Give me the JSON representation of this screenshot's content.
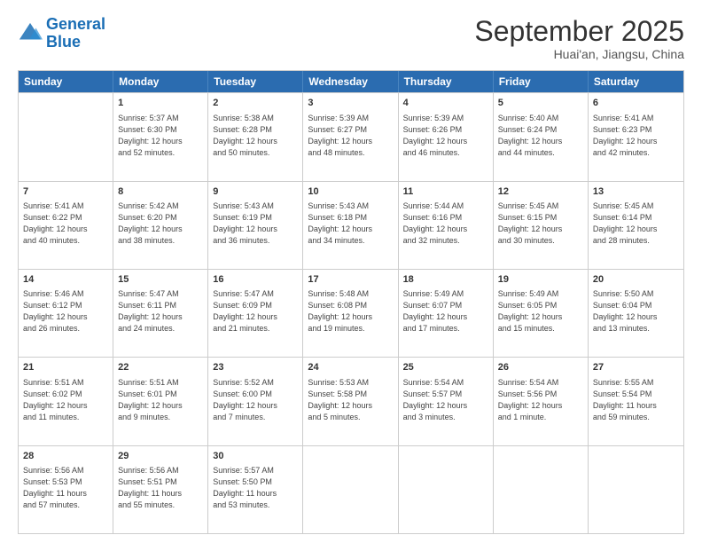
{
  "logo": {
    "line1": "General",
    "line2": "Blue"
  },
  "title": "September 2025",
  "subtitle": "Huai'an, Jiangsu, China",
  "days": [
    "Sunday",
    "Monday",
    "Tuesday",
    "Wednesday",
    "Thursday",
    "Friday",
    "Saturday"
  ],
  "rows": [
    [
      {
        "day": "",
        "text": ""
      },
      {
        "day": "1",
        "text": "Sunrise: 5:37 AM\nSunset: 6:30 PM\nDaylight: 12 hours\nand 52 minutes."
      },
      {
        "day": "2",
        "text": "Sunrise: 5:38 AM\nSunset: 6:28 PM\nDaylight: 12 hours\nand 50 minutes."
      },
      {
        "day": "3",
        "text": "Sunrise: 5:39 AM\nSunset: 6:27 PM\nDaylight: 12 hours\nand 48 minutes."
      },
      {
        "day": "4",
        "text": "Sunrise: 5:39 AM\nSunset: 6:26 PM\nDaylight: 12 hours\nand 46 minutes."
      },
      {
        "day": "5",
        "text": "Sunrise: 5:40 AM\nSunset: 6:24 PM\nDaylight: 12 hours\nand 44 minutes."
      },
      {
        "day": "6",
        "text": "Sunrise: 5:41 AM\nSunset: 6:23 PM\nDaylight: 12 hours\nand 42 minutes."
      }
    ],
    [
      {
        "day": "7",
        "text": "Sunrise: 5:41 AM\nSunset: 6:22 PM\nDaylight: 12 hours\nand 40 minutes."
      },
      {
        "day": "8",
        "text": "Sunrise: 5:42 AM\nSunset: 6:20 PM\nDaylight: 12 hours\nand 38 minutes."
      },
      {
        "day": "9",
        "text": "Sunrise: 5:43 AM\nSunset: 6:19 PM\nDaylight: 12 hours\nand 36 minutes."
      },
      {
        "day": "10",
        "text": "Sunrise: 5:43 AM\nSunset: 6:18 PM\nDaylight: 12 hours\nand 34 minutes."
      },
      {
        "day": "11",
        "text": "Sunrise: 5:44 AM\nSunset: 6:16 PM\nDaylight: 12 hours\nand 32 minutes."
      },
      {
        "day": "12",
        "text": "Sunrise: 5:45 AM\nSunset: 6:15 PM\nDaylight: 12 hours\nand 30 minutes."
      },
      {
        "day": "13",
        "text": "Sunrise: 5:45 AM\nSunset: 6:14 PM\nDaylight: 12 hours\nand 28 minutes."
      }
    ],
    [
      {
        "day": "14",
        "text": "Sunrise: 5:46 AM\nSunset: 6:12 PM\nDaylight: 12 hours\nand 26 minutes."
      },
      {
        "day": "15",
        "text": "Sunrise: 5:47 AM\nSunset: 6:11 PM\nDaylight: 12 hours\nand 24 minutes."
      },
      {
        "day": "16",
        "text": "Sunrise: 5:47 AM\nSunset: 6:09 PM\nDaylight: 12 hours\nand 21 minutes."
      },
      {
        "day": "17",
        "text": "Sunrise: 5:48 AM\nSunset: 6:08 PM\nDaylight: 12 hours\nand 19 minutes."
      },
      {
        "day": "18",
        "text": "Sunrise: 5:49 AM\nSunset: 6:07 PM\nDaylight: 12 hours\nand 17 minutes."
      },
      {
        "day": "19",
        "text": "Sunrise: 5:49 AM\nSunset: 6:05 PM\nDaylight: 12 hours\nand 15 minutes."
      },
      {
        "day": "20",
        "text": "Sunrise: 5:50 AM\nSunset: 6:04 PM\nDaylight: 12 hours\nand 13 minutes."
      }
    ],
    [
      {
        "day": "21",
        "text": "Sunrise: 5:51 AM\nSunset: 6:02 PM\nDaylight: 12 hours\nand 11 minutes."
      },
      {
        "day": "22",
        "text": "Sunrise: 5:51 AM\nSunset: 6:01 PM\nDaylight: 12 hours\nand 9 minutes."
      },
      {
        "day": "23",
        "text": "Sunrise: 5:52 AM\nSunset: 6:00 PM\nDaylight: 12 hours\nand 7 minutes."
      },
      {
        "day": "24",
        "text": "Sunrise: 5:53 AM\nSunset: 5:58 PM\nDaylight: 12 hours\nand 5 minutes."
      },
      {
        "day": "25",
        "text": "Sunrise: 5:54 AM\nSunset: 5:57 PM\nDaylight: 12 hours\nand 3 minutes."
      },
      {
        "day": "26",
        "text": "Sunrise: 5:54 AM\nSunset: 5:56 PM\nDaylight: 12 hours\nand 1 minute."
      },
      {
        "day": "27",
        "text": "Sunrise: 5:55 AM\nSunset: 5:54 PM\nDaylight: 11 hours\nand 59 minutes."
      }
    ],
    [
      {
        "day": "28",
        "text": "Sunrise: 5:56 AM\nSunset: 5:53 PM\nDaylight: 11 hours\nand 57 minutes."
      },
      {
        "day": "29",
        "text": "Sunrise: 5:56 AM\nSunset: 5:51 PM\nDaylight: 11 hours\nand 55 minutes."
      },
      {
        "day": "30",
        "text": "Sunrise: 5:57 AM\nSunset: 5:50 PM\nDaylight: 11 hours\nand 53 minutes."
      },
      {
        "day": "",
        "text": ""
      },
      {
        "day": "",
        "text": ""
      },
      {
        "day": "",
        "text": ""
      },
      {
        "day": "",
        "text": ""
      }
    ]
  ]
}
